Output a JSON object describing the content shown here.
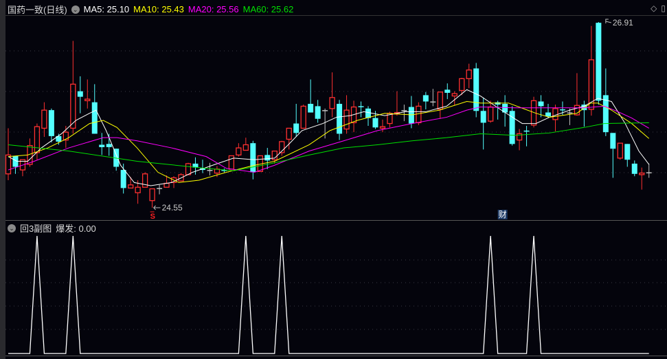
{
  "header": {
    "title": "国药一致(日线)",
    "ma5": "MA5: 25.10",
    "ma10": "MA10: 25.43",
    "ma20": "MA20: 25.56",
    "ma60": "MA60: 25.62"
  },
  "sub_header": {
    "title": "回3副图",
    "value": "爆发: 0.00"
  },
  "markers": {
    "high_label": "26.91",
    "low_label": "24.55",
    "s_label": "S",
    "cai_label": "财"
  },
  "colors": {
    "up": "#ff3030",
    "down": "#54ffff",
    "flat": "#c0c0c0",
    "ma5": "#ffffff",
    "ma10": "#ffff00",
    "ma20": "#ff00ff",
    "ma60": "#00e000",
    "bg": "#04040c"
  },
  "chart_data": [
    {
      "type": "candlestick",
      "title": "国药一致(日线)",
      "ylim": [
        24.55,
        26.91
      ],
      "grid": true,
      "ohlc": [
        [
          24.98,
          25.56,
          24.9,
          25.22
        ],
        [
          25.21,
          25.21,
          24.98,
          25.07
        ],
        [
          25.03,
          25.16,
          24.95,
          25.16
        ],
        [
          25.1,
          25.43,
          25.07,
          25.34
        ],
        [
          25.25,
          25.62,
          25.16,
          25.58
        ],
        [
          25.56,
          25.89,
          25.45,
          25.79
        ],
        [
          25.79,
          25.81,
          25.38,
          25.46
        ],
        [
          25.46,
          25.49,
          25.35,
          25.39
        ],
        [
          25.41,
          25.59,
          25.31,
          25.51
        ],
        [
          25.56,
          26.67,
          25.49,
          26.12
        ],
        [
          26.03,
          26.22,
          25.75,
          25.96
        ],
        [
          25.91,
          26.18,
          25.81,
          25.93
        ],
        [
          25.89,
          26.12,
          25.49,
          25.49
        ],
        [
          25.35,
          25.5,
          25.22,
          25.32
        ],
        [
          25.36,
          25.49,
          25.21,
          25.32
        ],
        [
          25.3,
          25.3,
          25.02,
          25.07
        ],
        [
          25.03,
          25.11,
          24.73,
          24.8
        ],
        [
          24.8,
          24.94,
          24.8,
          24.84
        ],
        [
          24.74,
          24.9,
          24.6,
          24.81
        ],
        [
          24.81,
          25.0,
          24.81,
          24.98
        ],
        [
          24.64,
          24.79,
          24.55,
          24.79
        ],
        [
          24.8,
          24.84,
          24.72,
          24.8
        ],
        [
          24.81,
          24.96,
          24.81,
          24.86
        ],
        [
          24.87,
          24.95,
          24.8,
          24.93
        ],
        [
          24.89,
          24.99,
          24.89,
          24.97
        ],
        [
          24.97,
          25.12,
          24.97,
          25.11
        ],
        [
          25.11,
          25.19,
          24.97,
          25.06
        ],
        [
          25.05,
          25.16,
          24.99,
          25.03
        ],
        [
          25.03,
          25.12,
          24.96,
          25.03
        ],
        [
          24.99,
          25.08,
          24.94,
          25.04
        ],
        [
          25.03,
          25.05,
          25.0,
          25.02
        ],
        [
          25.04,
          25.21,
          25.04,
          25.21
        ],
        [
          25.22,
          25.37,
          25.2,
          25.31
        ],
        [
          25.28,
          25.44,
          25.28,
          25.35
        ],
        [
          25.37,
          25.4,
          24.91,
          25.0
        ],
        [
          25.01,
          25.21,
          25.01,
          25.21
        ],
        [
          25.22,
          25.31,
          25.04,
          25.15
        ],
        [
          25.16,
          25.27,
          25.11,
          25.27
        ],
        [
          25.25,
          25.4,
          25.21,
          25.39
        ],
        [
          25.42,
          25.56,
          25.29,
          25.56
        ],
        [
          25.62,
          25.87,
          25.45,
          25.5
        ],
        [
          25.56,
          25.86,
          25.56,
          25.84
        ],
        [
          25.87,
          26.18,
          25.76,
          25.76
        ],
        [
          25.84,
          25.92,
          25.63,
          25.68
        ],
        [
          25.79,
          25.81,
          25.43,
          25.79
        ],
        [
          25.81,
          26.27,
          25.7,
          25.95
        ],
        [
          25.87,
          25.92,
          25.41,
          25.49
        ],
        [
          25.55,
          25.98,
          25.49,
          25.79
        ],
        [
          25.63,
          25.91,
          25.51,
          25.83
        ],
        [
          25.84,
          25.9,
          25.7,
          25.83
        ],
        [
          25.81,
          25.84,
          25.59,
          25.69
        ],
        [
          25.69,
          25.78,
          25.55,
          25.57
        ],
        [
          25.56,
          25.67,
          25.51,
          25.58
        ],
        [
          25.62,
          25.77,
          25.57,
          25.75
        ],
        [
          25.74,
          26.03,
          25.72,
          25.76
        ],
        [
          25.79,
          25.86,
          25.65,
          25.79
        ],
        [
          25.83,
          25.97,
          25.56,
          25.62
        ],
        [
          25.63,
          25.89,
          25.6,
          25.84
        ],
        [
          25.98,
          26.02,
          25.8,
          25.9
        ],
        [
          25.9,
          26.06,
          25.84,
          25.9
        ],
        [
          25.8,
          26.02,
          25.68,
          26.02
        ],
        [
          26.05,
          26.13,
          25.93,
          26.01
        ],
        [
          25.97,
          26.03,
          25.85,
          26.0
        ],
        [
          26.04,
          26.2,
          25.98,
          26.19
        ],
        [
          26.19,
          26.38,
          26.07,
          26.3
        ],
        [
          26.32,
          26.39,
          25.7,
          25.78
        ],
        [
          25.78,
          25.95,
          25.29,
          25.63
        ],
        [
          25.65,
          25.91,
          25.63,
          25.83
        ],
        [
          25.89,
          25.91,
          25.67,
          25.86
        ],
        [
          25.87,
          25.98,
          25.58,
          25.76
        ],
        [
          25.78,
          25.84,
          25.34,
          25.36
        ],
        [
          25.41,
          25.55,
          25.28,
          25.49
        ],
        [
          25.53,
          25.59,
          25.33,
          25.52
        ],
        [
          25.6,
          25.96,
          25.57,
          25.91
        ],
        [
          25.9,
          25.98,
          25.7,
          25.84
        ],
        [
          25.76,
          25.87,
          25.69,
          25.71
        ],
        [
          25.67,
          25.86,
          25.52,
          25.81
        ],
        [
          25.8,
          25.9,
          25.73,
          25.79
        ],
        [
          25.76,
          25.81,
          25.6,
          25.76
        ],
        [
          25.73,
          26.26,
          25.72,
          25.85
        ],
        [
          25.86,
          25.91,
          25.58,
          25.79
        ],
        [
          25.8,
          26.86,
          25.72,
          26.43
        ],
        [
          26.9,
          26.91,
          25.86,
          25.91
        ],
        [
          25.98,
          26.32,
          25.46,
          25.51
        ],
        [
          25.5,
          25.5,
          24.93,
          25.3
        ],
        [
          25.18,
          25.37,
          25.16,
          25.37
        ],
        [
          25.36,
          25.36,
          25.07,
          25.16
        ],
        [
          25.11,
          25.15,
          24.95,
          24.98
        ],
        [
          24.97,
          25.06,
          24.78,
          24.99
        ],
        [
          25.0,
          25.11,
          24.93,
          25.0
        ]
      ],
      "ma_series": [
        {
          "name": "MA5",
          "points": [
            [
              0,
              25.2
            ],
            [
              1.2,
              25.14
            ],
            [
              2.7,
              25.14
            ],
            [
              4.6,
              25.31
            ],
            [
              7.4,
              25.49
            ],
            [
              9.4,
              25.66
            ],
            [
              11.3,
              25.75
            ],
            [
              12.2,
              25.79
            ],
            [
              13.6,
              25.53
            ],
            [
              15.6,
              25.09
            ],
            [
              17.5,
              24.87
            ],
            [
              19.8,
              24.83
            ],
            [
              22.7,
              24.87
            ],
            [
              25.6,
              25.0
            ],
            [
              28.4,
              25.09
            ],
            [
              31.3,
              25.18
            ],
            [
              34.2,
              25.16
            ],
            [
              37,
              25.18
            ],
            [
              38.9,
              25.35
            ],
            [
              40.8,
              25.53
            ],
            [
              43.7,
              25.62
            ],
            [
              45.6,
              25.7
            ],
            [
              47.5,
              25.72
            ],
            [
              49.4,
              25.77
            ],
            [
              52.3,
              25.72
            ],
            [
              55.2,
              25.77
            ],
            [
              58,
              25.77
            ],
            [
              60.9,
              25.84
            ],
            [
              63.7,
              26.05
            ],
            [
              65.6,
              25.97
            ],
            [
              68.5,
              25.79
            ],
            [
              71.4,
              25.62
            ],
            [
              73.3,
              25.62
            ],
            [
              75.2,
              25.7
            ],
            [
              78,
              25.79
            ],
            [
              80,
              25.84
            ],
            [
              81.9,
              25.94
            ],
            [
              83.8,
              25.9
            ],
            [
              85.7,
              25.62
            ],
            [
              87.6,
              25.27
            ],
            [
              89,
              25.1
            ]
          ]
        },
        {
          "name": "MA10",
          "points": [
            [
              0,
              25.2
            ],
            [
              2.7,
              25.22
            ],
            [
              5.5,
              25.31
            ],
            [
              8.4,
              25.44
            ],
            [
              11.3,
              25.62
            ],
            [
              13.2,
              25.66
            ],
            [
              15.1,
              25.57
            ],
            [
              17.9,
              25.31
            ],
            [
              20.8,
              25.0
            ],
            [
              23.7,
              24.87
            ],
            [
              26.5,
              24.9
            ],
            [
              30.3,
              25.0
            ],
            [
              34.2,
              25.09
            ],
            [
              37,
              25.14
            ],
            [
              41.8,
              25.35
            ],
            [
              44.7,
              25.53
            ],
            [
              48.5,
              25.66
            ],
            [
              52.3,
              25.75
            ],
            [
              56.1,
              25.73
            ],
            [
              59.9,
              25.79
            ],
            [
              63.7,
              25.9
            ],
            [
              65.6,
              25.88
            ],
            [
              69.5,
              25.88
            ],
            [
              73.3,
              25.75
            ],
            [
              75.2,
              25.7
            ],
            [
              79,
              25.75
            ],
            [
              80.9,
              25.88
            ],
            [
              81.9,
              25.88
            ],
            [
              83.8,
              25.79
            ],
            [
              86.6,
              25.62
            ],
            [
              89,
              25.43
            ]
          ]
        },
        {
          "name": "MA20",
          "points": [
            [
              0,
              25.03
            ],
            [
              3.6,
              25.14
            ],
            [
              8.4,
              25.31
            ],
            [
              13.2,
              25.44
            ],
            [
              15.1,
              25.44
            ],
            [
              17.9,
              25.4
            ],
            [
              22.7,
              25.31
            ],
            [
              27.5,
              25.2
            ],
            [
              30.3,
              25.05
            ],
            [
              34.2,
              25.0
            ],
            [
              37,
              25.09
            ],
            [
              41.8,
              25.27
            ],
            [
              46.6,
              25.4
            ],
            [
              51.3,
              25.53
            ],
            [
              56.1,
              25.62
            ],
            [
              60.9,
              25.7
            ],
            [
              63.7,
              25.79
            ],
            [
              65.6,
              25.83
            ],
            [
              70.4,
              25.82
            ],
            [
              75.2,
              25.82
            ],
            [
              80,
              25.82
            ],
            [
              82.8,
              25.84
            ],
            [
              84.7,
              25.77
            ],
            [
              86.6,
              25.69
            ],
            [
              89,
              25.56
            ]
          ]
        },
        {
          "name": "MA60",
          "points": [
            [
              0,
              25.35
            ],
            [
              8.4,
              25.27
            ],
            [
              17.9,
              25.14
            ],
            [
              27.5,
              25.05
            ],
            [
              31.3,
              25.02
            ],
            [
              37,
              25.12
            ],
            [
              41.8,
              25.22
            ],
            [
              46.6,
              25.31
            ],
            [
              51.3,
              25.35
            ],
            [
              56.1,
              25.4
            ],
            [
              60.9,
              25.44
            ],
            [
              65.6,
              25.49
            ],
            [
              70.4,
              25.47
            ],
            [
              75.2,
              25.5
            ],
            [
              80,
              25.57
            ],
            [
              82.8,
              25.62
            ],
            [
              89,
              25.63
            ]
          ]
        }
      ],
      "annotations": [
        {
          "candle": 83,
          "text": "26.91",
          "kind": "high"
        },
        {
          "candle": 20,
          "text": "24.55",
          "kind": "low"
        },
        {
          "candle": 20,
          "text": "S"
        },
        {
          "candle": 68,
          "text": "财"
        }
      ]
    },
    {
      "type": "line",
      "title": "回3副图",
      "series_name": "爆发",
      "ylim": [
        0,
        1
      ],
      "spikes_at": [
        4,
        9,
        33,
        38,
        67,
        73
      ],
      "count": 90
    }
  ]
}
